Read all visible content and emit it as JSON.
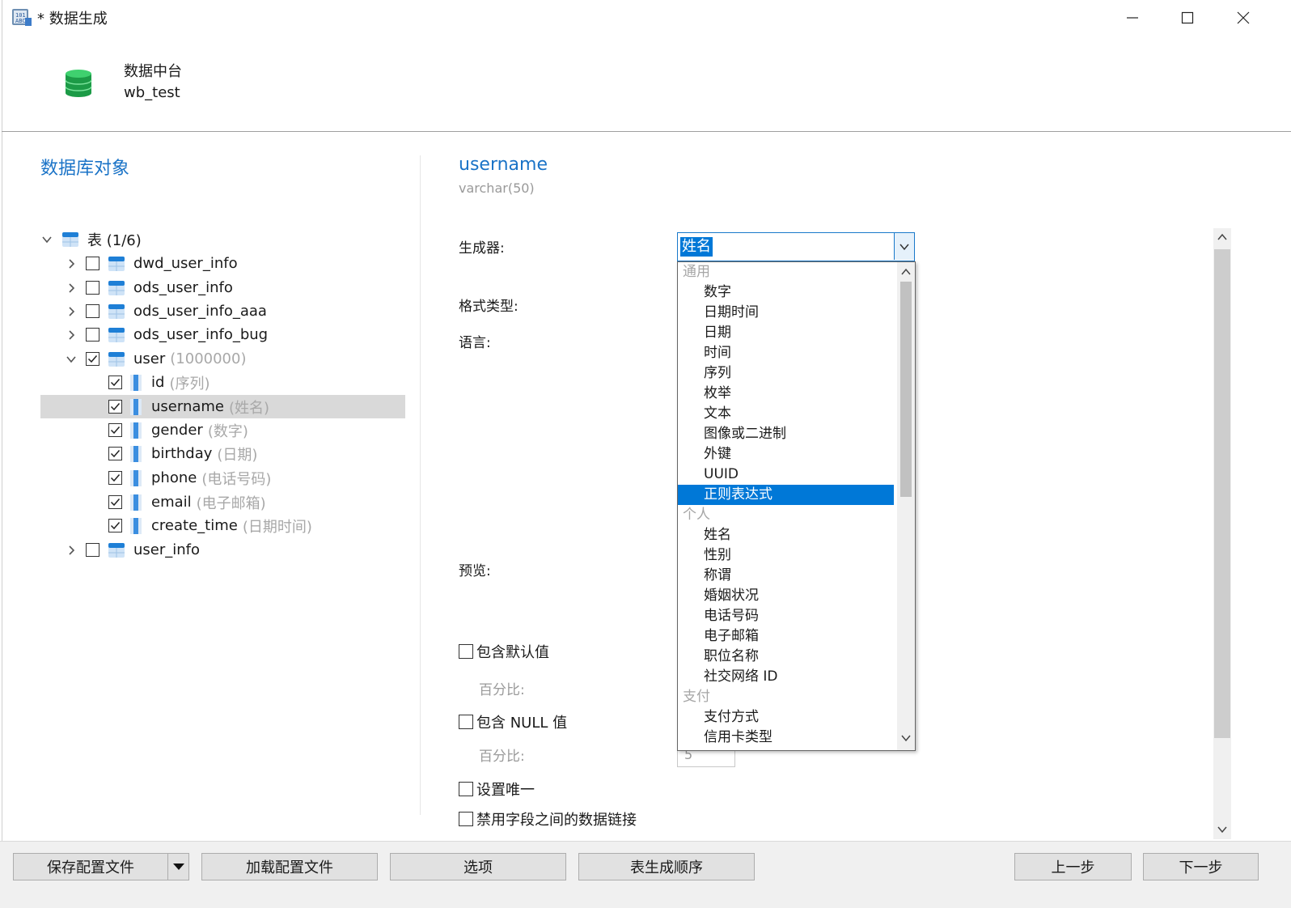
{
  "window": {
    "title": "* 数据生成",
    "minimize_icon": "minimize-icon",
    "maximize_icon": "maximize-icon",
    "close_icon": "close-icon"
  },
  "header": {
    "connection_name": "数据中台",
    "database_name": "wb_test",
    "icon": "database-icon",
    "icon_color": "#1faa4f"
  },
  "left_pane": {
    "title": "数据库对象",
    "tree": {
      "root_label": "表 (1/6)",
      "tables": [
        {
          "name": "dwd_user_info",
          "checked": false,
          "expanded": false
        },
        {
          "name": "ods_user_info",
          "checked": false,
          "expanded": false
        },
        {
          "name": "ods_user_info_aaa",
          "checked": false,
          "expanded": false
        },
        {
          "name": "ods_user_info_bug",
          "checked": false,
          "expanded": false
        },
        {
          "name": "user",
          "hint": "(1000000)",
          "checked": true,
          "expanded": true
        },
        {
          "name": "user_info",
          "checked": false,
          "expanded": false
        }
      ],
      "columns": [
        {
          "name": "id",
          "hint": "(序列)",
          "checked": true,
          "selected": false
        },
        {
          "name": "username",
          "hint": "(姓名)",
          "checked": true,
          "selected": true
        },
        {
          "name": "gender",
          "hint": "(数字)",
          "checked": true,
          "selected": false
        },
        {
          "name": "birthday",
          "hint": "(日期)",
          "checked": true,
          "selected": false
        },
        {
          "name": "phone",
          "hint": "(电话号码)",
          "checked": true,
          "selected": false
        },
        {
          "name": "email",
          "hint": "(电子邮箱)",
          "checked": true,
          "selected": false
        },
        {
          "name": "create_time",
          "hint": "(日期时间)",
          "checked": true,
          "selected": false
        }
      ]
    }
  },
  "field_panel": {
    "column_name": "username",
    "column_type": "varchar(50)",
    "labels": {
      "generator": "生成器:",
      "format_type": "格式类型:",
      "language": "语言:",
      "preview": "预览:",
      "percent_1": "百分比:",
      "percent_2": "百分比:"
    },
    "generator_value": "姓名",
    "percent_2_value": "5",
    "options": {
      "include_default": "包含默认值",
      "include_null": "包含 NULL 值",
      "set_unique": "设置唯一",
      "disable_link": "禁用字段之间的数据链接"
    }
  },
  "generator_list": {
    "items": [
      {
        "label": "通用",
        "kind": "group"
      },
      {
        "label": "数字",
        "kind": "item"
      },
      {
        "label": "日期时间",
        "kind": "item"
      },
      {
        "label": "日期",
        "kind": "item"
      },
      {
        "label": "时间",
        "kind": "item"
      },
      {
        "label": "序列",
        "kind": "item"
      },
      {
        "label": "枚举",
        "kind": "item"
      },
      {
        "label": "文本",
        "kind": "item"
      },
      {
        "label": "图像或二进制",
        "kind": "item"
      },
      {
        "label": "外键",
        "kind": "item"
      },
      {
        "label": "UUID",
        "kind": "item"
      },
      {
        "label": "正则表达式",
        "kind": "item",
        "highlighted": true
      },
      {
        "label": "个人",
        "kind": "group"
      },
      {
        "label": "姓名",
        "kind": "item"
      },
      {
        "label": "性别",
        "kind": "item"
      },
      {
        "label": "称谓",
        "kind": "item"
      },
      {
        "label": "婚姻状况",
        "kind": "item"
      },
      {
        "label": "电话号码",
        "kind": "item"
      },
      {
        "label": "电子邮箱",
        "kind": "item"
      },
      {
        "label": "职位名称",
        "kind": "item"
      },
      {
        "label": "社交网络 ID",
        "kind": "item"
      },
      {
        "label": "支付",
        "kind": "group"
      },
      {
        "label": "支付方式",
        "kind": "item"
      },
      {
        "label": "信用卡类型",
        "kind": "item"
      }
    ],
    "highlight_color": "#0078d7"
  },
  "footer": {
    "save_config": "保存配置文件",
    "load_config": "加载配置文件",
    "options": "选项",
    "table_order": "表生成顺序",
    "prev": "上一步",
    "next": "下一步"
  },
  "colors": {
    "accent_text": "#1a73c7",
    "hint_text": "#a8a8a8"
  }
}
